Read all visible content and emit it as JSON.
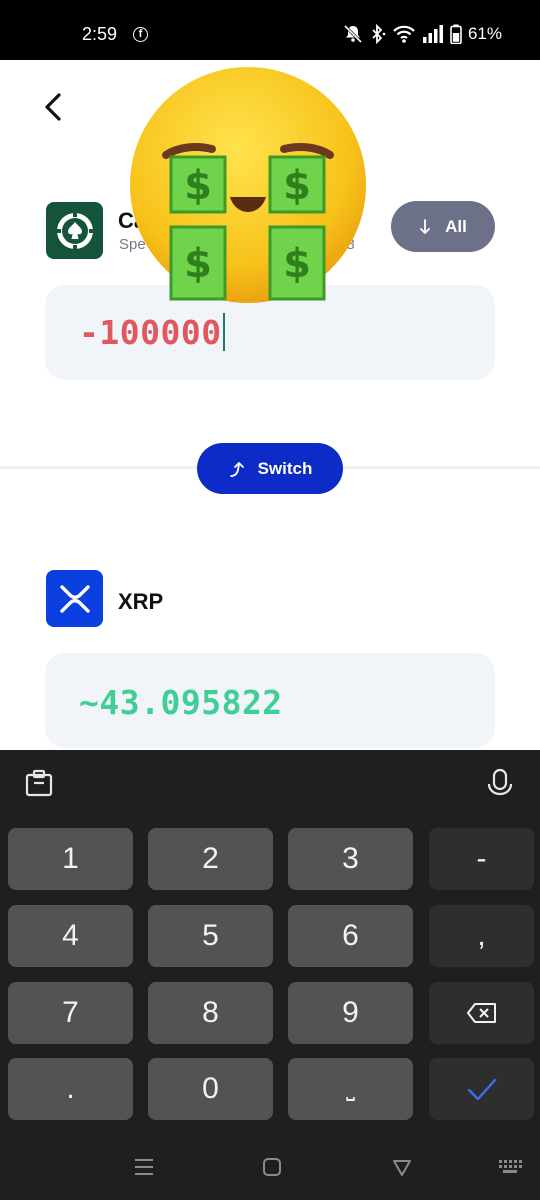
{
  "status_bar": {
    "time": "2:59",
    "fb_glyph": "f",
    "battery": "61%",
    "icons": [
      "facebook-icon",
      "silent-icon",
      "bluetooth-icon",
      "wifi-icon",
      "signal-icon",
      "battery-icon"
    ]
  },
  "from": {
    "name": "Ca",
    "sub": "Spe",
    "sub_tail": "98",
    "amount": "-100000",
    "all_label": "All"
  },
  "switch_label": "Switch",
  "to": {
    "name": "XRP",
    "amount": "~43.095822"
  },
  "keyboard": {
    "keys": [
      "1",
      "2",
      "3",
      "-",
      "4",
      "5",
      "6",
      ",",
      "7",
      "8",
      "9",
      ".",
      "0",
      "⎵"
    ]
  },
  "colors": {
    "primary": "#0d2cc7",
    "negative": "#e0585f",
    "positive": "#3fcf96",
    "casino_icon_bg": "#13543b",
    "xrp_icon_bg": "#0c3fe0"
  }
}
